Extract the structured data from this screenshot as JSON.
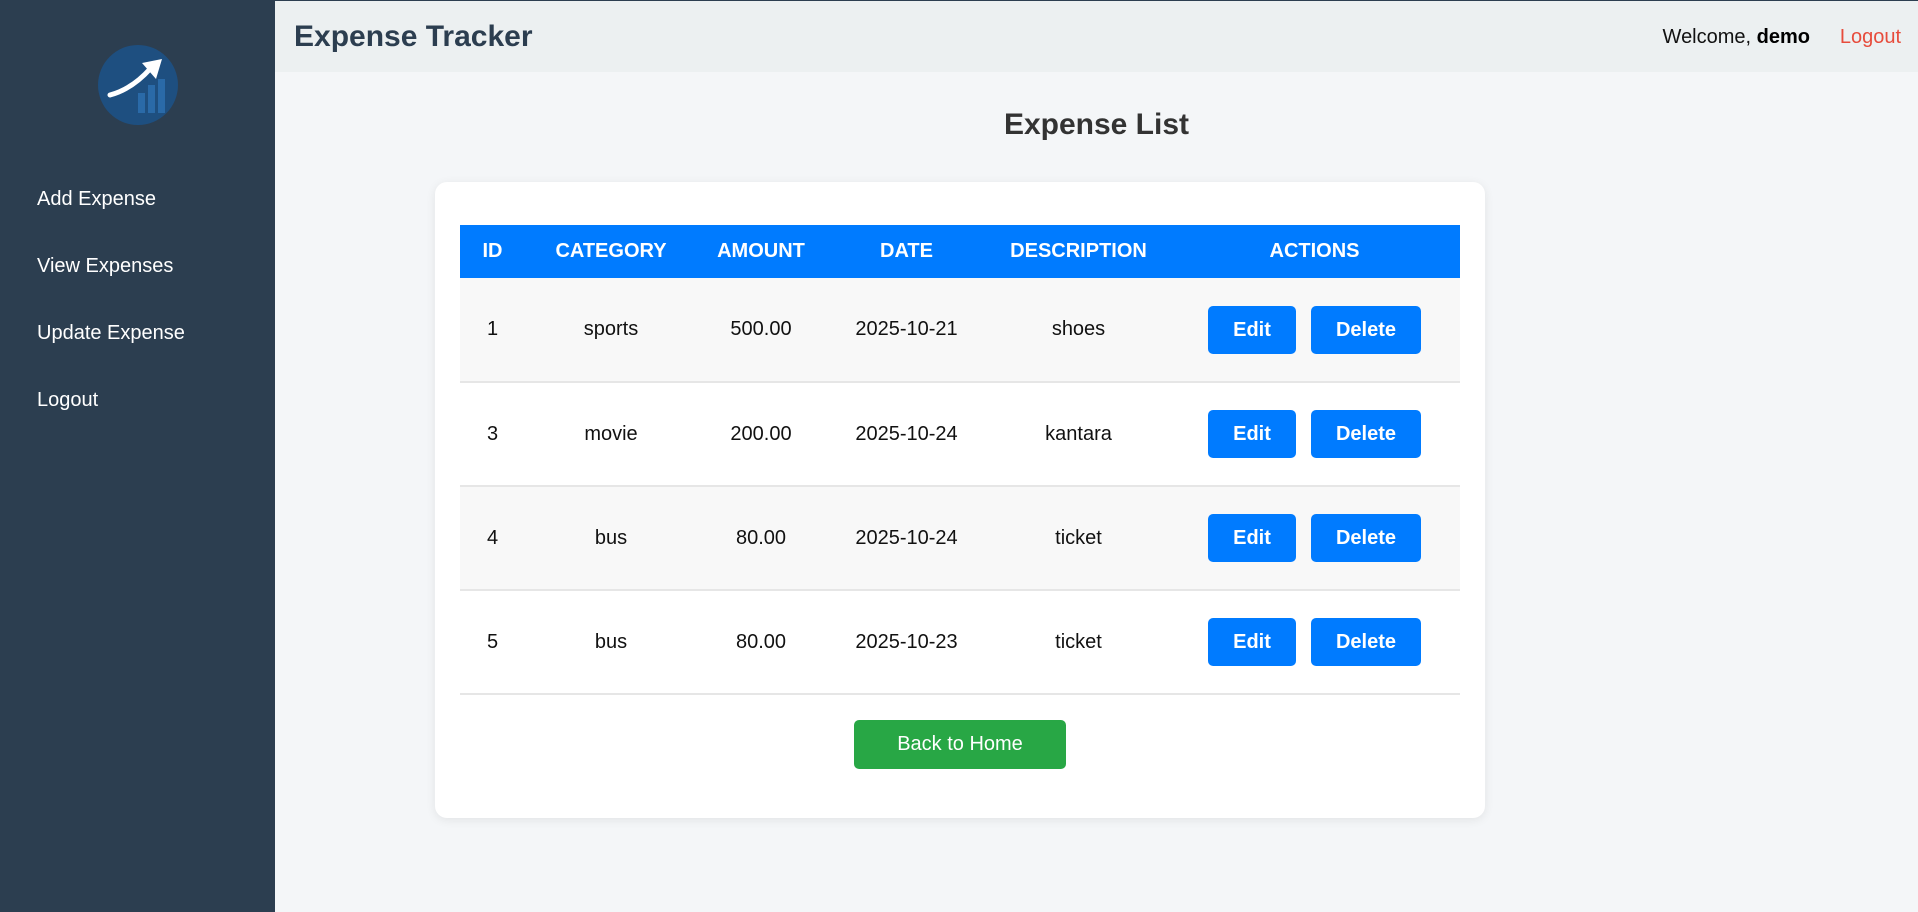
{
  "header": {
    "app_title": "Expense Tracker",
    "welcome_prefix": "Welcome, ",
    "username": "demo",
    "logout_label": "Logout"
  },
  "sidebar": {
    "logo_icon": "trending-up-chart-icon",
    "items": [
      {
        "label": "Add Expense"
      },
      {
        "label": "View Expenses"
      },
      {
        "label": "Update Expense"
      },
      {
        "label": "Logout"
      }
    ]
  },
  "main": {
    "page_title": "Expense List",
    "table": {
      "columns": [
        "ID",
        "CATEGORY",
        "AMOUNT",
        "DATE",
        "DESCRIPTION",
        "ACTIONS"
      ],
      "rows": [
        {
          "id": "1",
          "category": "sports",
          "amount": "500.00",
          "date": "2025-10-21",
          "description": "shoes",
          "edit_label": "Edit",
          "delete_label": "Delete"
        },
        {
          "id": "3",
          "category": "movie",
          "amount": "200.00",
          "date": "2025-10-24",
          "description": "kantara",
          "edit_label": "Edit",
          "delete_label": "Delete"
        },
        {
          "id": "4",
          "category": "bus",
          "amount": "80.00",
          "date": "2025-10-24",
          "description": "ticket",
          "edit_label": "Edit",
          "delete_label": "Delete"
        },
        {
          "id": "5",
          "category": "bus",
          "amount": "80.00",
          "date": "2025-10-23",
          "description": "ticket",
          "edit_label": "Edit",
          "delete_label": "Delete"
        }
      ]
    },
    "back_button_label": "Back to Home"
  },
  "colors": {
    "sidebar_bg": "#2c3e50",
    "header_bg": "#ecf0f1",
    "table_header": "#007bff",
    "primary_button": "#007bff",
    "back_button": "#28a745",
    "logout_link": "#e74c3c"
  }
}
